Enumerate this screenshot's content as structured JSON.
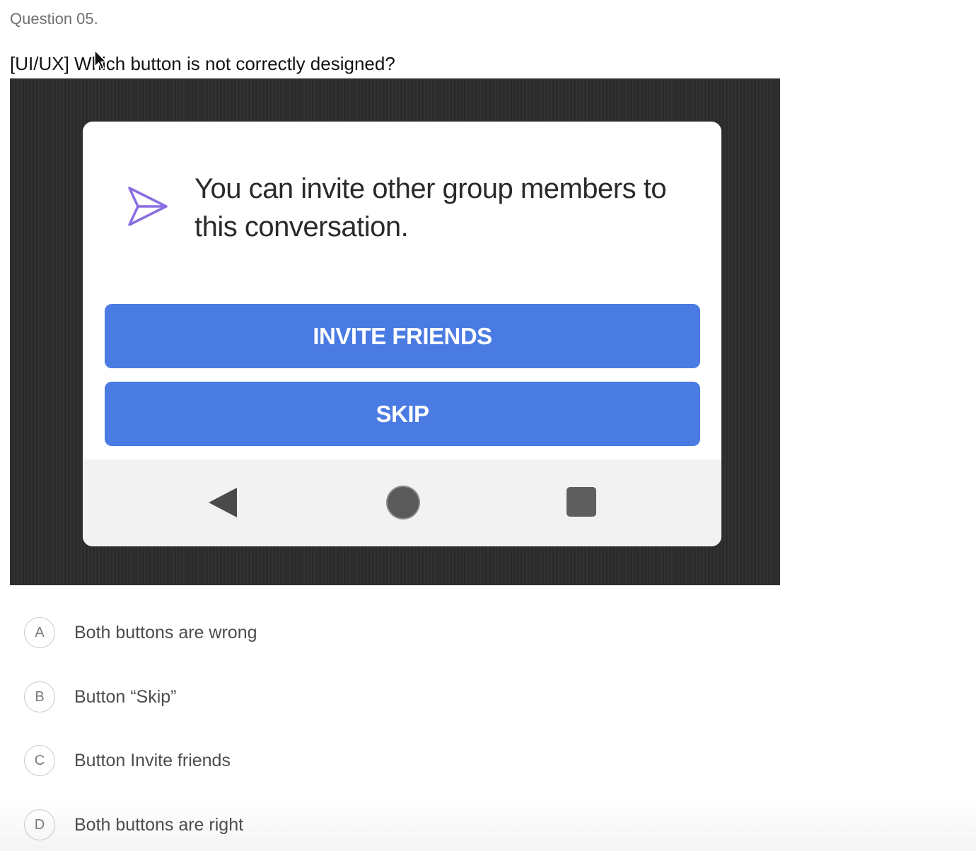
{
  "question": {
    "number_label": "Question 05.",
    "text": "[UI/UX] Which button is not correctly designed?"
  },
  "image": {
    "message": "You can invite other group members to this conversation.",
    "primary_button_label": "INVITE FRIENDS",
    "secondary_button_label": "SKIP",
    "button_color": "#4a7be2",
    "icons": [
      "send-icon",
      "back-icon",
      "home-icon",
      "recent-apps-icon"
    ]
  },
  "options": [
    {
      "letter": "A",
      "label": "Both buttons are wrong"
    },
    {
      "letter": "B",
      "label": "Button “Skip”"
    },
    {
      "letter": "C",
      "label": "Button Invite friends"
    },
    {
      "letter": "D",
      "label": "Both buttons are right"
    }
  ]
}
